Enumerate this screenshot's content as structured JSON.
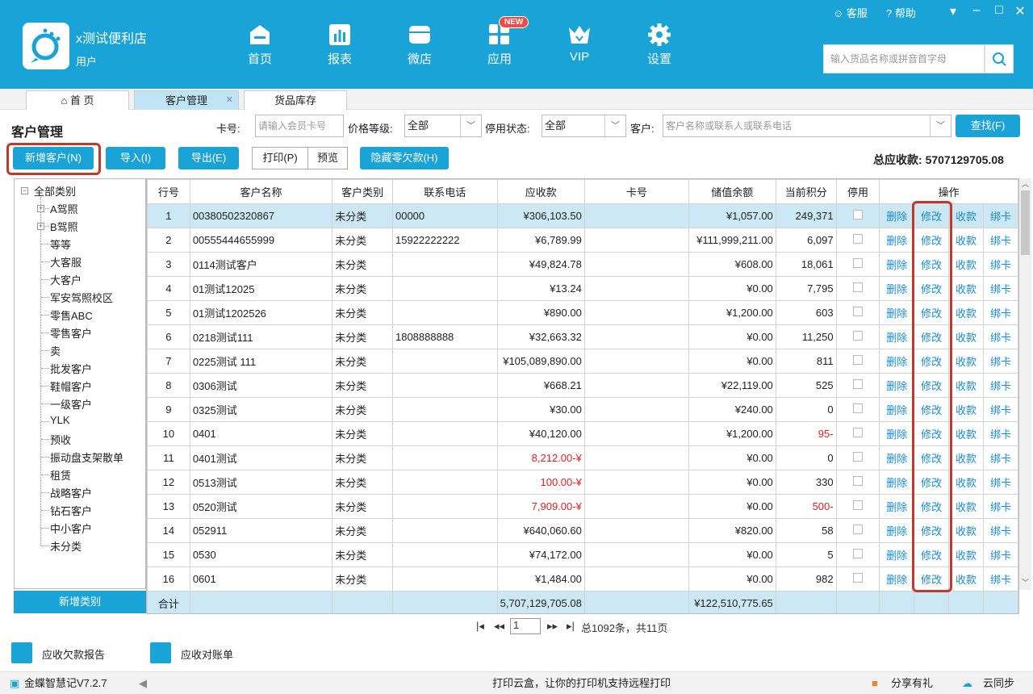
{
  "app": {
    "shop_name": "x测试便利店",
    "role": "用户",
    "help": "帮助",
    "service": "客服"
  },
  "nav": [
    {
      "label": "首页",
      "icon": "home-icon"
    },
    {
      "label": "报表",
      "icon": "report-icon"
    },
    {
      "label": "微店",
      "icon": "shop-icon"
    },
    {
      "label": "应用",
      "icon": "apps-icon",
      "badge": "NEW"
    },
    {
      "label": "VIP",
      "icon": "crown-icon"
    },
    {
      "label": "设置",
      "icon": "gear-icon"
    }
  ],
  "search": {
    "placeholder": "输入货品名称或拼音首字母"
  },
  "tabs": [
    {
      "label": "首 页"
    },
    {
      "label": "客户管理"
    },
    {
      "label": "货品库存"
    }
  ],
  "page": {
    "title": "客户管理"
  },
  "filters": {
    "card_label": "卡号:",
    "card_placeholder": "请输入会员卡号",
    "price_label": "价格等级:",
    "price_value": "全部",
    "status_label": "停用状态:",
    "status_value": "全部",
    "customer_label": "客户:",
    "customer_placeholder": "客户名称或联系人或联系电话",
    "find_button": "查找(F)"
  },
  "toolbar": {
    "add": "新增客户(N)",
    "import": "导入(I)",
    "export": "导出(E)",
    "print": "打印(P)",
    "preview": "预览",
    "hide_zero": "隐藏零欠款(H)",
    "total_label": "总应收款:",
    "total_value": "5707129705.08"
  },
  "tree": {
    "root": "全部类别",
    "items": [
      "A驾照",
      "B驾照",
      "等等",
      "大客服",
      "大客户",
      "军安驾照校区",
      "零售ABC",
      "零售客户",
      "卖",
      "批发客户",
      "鞋帽客户",
      "一级客户",
      "YLK",
      "预收",
      "振动盘支架散单",
      "租赁",
      "战略客户",
      "钻石客户",
      "中小客户",
      "未分类"
    ],
    "add_button": "新增类别"
  },
  "table": {
    "headers": [
      "行号",
      "客户名称",
      "客户类别",
      "联系电话",
      "应收款",
      "卡号",
      "储值余额",
      "当前积分",
      "停用",
      "操作"
    ],
    "actions": [
      "删除",
      "修改",
      "收款",
      "绑卡"
    ],
    "rows": [
      {
        "no": "1",
        "name": "00380502320867",
        "cat": "未分类",
        "phone": "00000",
        "recv": "¥306,103.50",
        "card": "",
        "bal": "¥1,057.00",
        "pts": "249,371",
        "neg_recv": false,
        "neg_pts": false
      },
      {
        "no": "2",
        "name": "00555444655999",
        "cat": "未分类",
        "phone": "15922222222",
        "recv": "¥6,789.99",
        "card": "",
        "bal": "¥111,999,211.00",
        "pts": "6,097",
        "neg_recv": false,
        "neg_pts": false
      },
      {
        "no": "3",
        "name": "0114测试客户",
        "cat": "未分类",
        "phone": "",
        "recv": "¥49,824.78",
        "card": "",
        "bal": "¥608.00",
        "pts": "18,061",
        "neg_recv": false,
        "neg_pts": false
      },
      {
        "no": "4",
        "name": "01测试12025",
        "cat": "未分类",
        "phone": "",
        "recv": "¥13.24",
        "card": "",
        "bal": "¥0.00",
        "pts": "7,795",
        "neg_recv": false,
        "neg_pts": false
      },
      {
        "no": "5",
        "name": "01测试1202526",
        "cat": "未分类",
        "phone": "",
        "recv": "¥890.00",
        "card": "",
        "bal": "¥1,200.00",
        "pts": "603",
        "neg_recv": false,
        "neg_pts": false
      },
      {
        "no": "6",
        "name": "0218测试111",
        "cat": "未分类",
        "phone": "1808888888",
        "recv": "¥32,663.32",
        "card": "",
        "bal": "¥0.00",
        "pts": "11,250",
        "neg_recv": false,
        "neg_pts": false
      },
      {
        "no": "7",
        "name": "0225测试 111",
        "cat": "未分类",
        "phone": "",
        "recv": "¥105,089,890.00",
        "card": "",
        "bal": "¥0.00",
        "pts": "811",
        "neg_recv": false,
        "neg_pts": false
      },
      {
        "no": "8",
        "name": "0306测试",
        "cat": "未分类",
        "phone": "",
        "recv": "¥668.21",
        "card": "",
        "bal": "¥22,119.00",
        "pts": "525",
        "neg_recv": false,
        "neg_pts": false
      },
      {
        "no": "9",
        "name": "0325测试",
        "cat": "未分类",
        "phone": "",
        "recv": "¥30.00",
        "card": "",
        "bal": "¥240.00",
        "pts": "0",
        "neg_recv": false,
        "neg_pts": false
      },
      {
        "no": "10",
        "name": "0401",
        "cat": "未分类",
        "phone": "",
        "recv": "¥40,120.00",
        "card": "",
        "bal": "¥1,200.00",
        "pts": "-95",
        "neg_recv": false,
        "neg_pts": true
      },
      {
        "no": "11",
        "name": "0401测试",
        "cat": "未分类",
        "phone": "",
        "recv": "¥-8,212.00",
        "card": "",
        "bal": "¥0.00",
        "pts": "0",
        "neg_recv": true,
        "neg_pts": false
      },
      {
        "no": "12",
        "name": "0513测试",
        "cat": "未分类",
        "phone": "",
        "recv": "¥-100.00",
        "card": "",
        "bal": "¥0.00",
        "pts": "330",
        "neg_recv": true,
        "neg_pts": false
      },
      {
        "no": "13",
        "name": "0520测试",
        "cat": "未分类",
        "phone": "",
        "recv": "¥-7,909.00",
        "card": "",
        "bal": "¥0.00",
        "pts": "-500",
        "neg_recv": true,
        "neg_pts": true
      },
      {
        "no": "14",
        "name": "052911",
        "cat": "未分类",
        "phone": "",
        "recv": "¥640,060.60",
        "card": "",
        "bal": "¥820.00",
        "pts": "58",
        "neg_recv": false,
        "neg_pts": false
      },
      {
        "no": "15",
        "name": "0530",
        "cat": "未分类",
        "phone": "",
        "recv": "¥74,172.00",
        "card": "",
        "bal": "¥0.00",
        "pts": "5",
        "neg_recv": false,
        "neg_pts": false
      },
      {
        "no": "16",
        "name": "0601",
        "cat": "未分类",
        "phone": "",
        "recv": "¥1,484.00",
        "card": "",
        "bal": "¥0.00",
        "pts": "982",
        "neg_recv": false,
        "neg_pts": false
      }
    ],
    "footer": {
      "label": "合计",
      "recv": "5,707,129,705.08",
      "bal": "¥122,510,775.65"
    }
  },
  "pager": {
    "page": "1",
    "summary": "总1092条，共11页"
  },
  "reports": {
    "recv_report": "应收欠款报告",
    "statement": "应收对账单"
  },
  "status": {
    "version": "金蝶智慧记V7.2.7",
    "message": "打印云盒，让你的打印机支持远程打印",
    "share": "分享有礼",
    "sync": "云同步"
  },
  "colors": {
    "primary": "#1aa3d6",
    "negative": "#e02020",
    "highlight": "#c0392b",
    "link": "#1a8bd0"
  }
}
